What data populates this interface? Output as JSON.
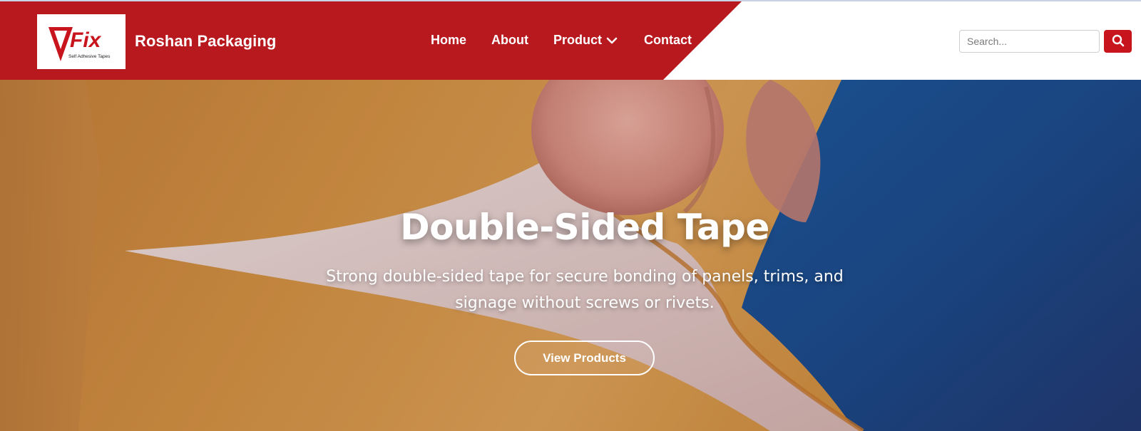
{
  "header": {
    "logo": {
      "mark": "VFix",
      "tagline": "Self Adhesive Tapes",
      "colors": {
        "accent": "#c8141c",
        "text": "#1a1a1a"
      }
    },
    "brand_name": "Roshan Packaging",
    "nav": [
      {
        "label": "Home"
      },
      {
        "label": "About"
      },
      {
        "label": "Product",
        "has_dropdown": true,
        "icon": "chevron-down-icon"
      },
      {
        "label": "Contact"
      }
    ],
    "search": {
      "placeholder": "Search...",
      "value": "",
      "button_icon": "search-icon"
    },
    "colors": {
      "primary": "#b8191e",
      "button": "#c8141c",
      "background": "#ffffff"
    }
  },
  "hero": {
    "title": "Double-Sided Tape",
    "subtitle": "Strong double-sided tape for secure bonding of panels, trims, and signage without screws or rivets.",
    "cta_label": "View Products",
    "background_image": "photo of a finger peeling a double-sided tape liner on orange and blue surfaces",
    "colors": {
      "text": "#ffffff"
    }
  }
}
